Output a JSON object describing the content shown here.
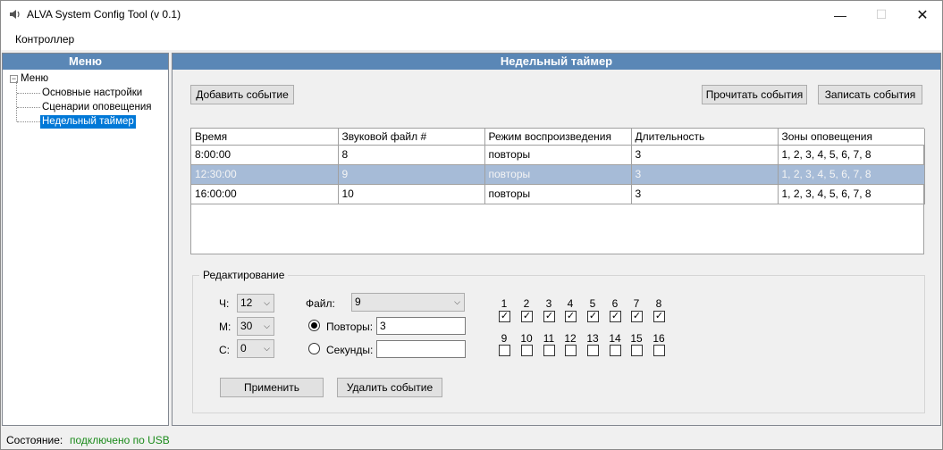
{
  "window": {
    "title": "ALVA System Config Tool (v 0.1)",
    "min_glyph": "—",
    "max_glyph": "☐",
    "close_glyph": "✕"
  },
  "menubar": {
    "controller": "Контроллер"
  },
  "sidebar": {
    "header": "Меню",
    "root": "Меню",
    "items": [
      {
        "label": "Основные настройки"
      },
      {
        "label": "Сценарии оповещения"
      },
      {
        "label": "Недельный таймер"
      }
    ]
  },
  "main": {
    "header": "Недельный таймер",
    "add_event": "Добавить событие",
    "read_events": "Прочитать события",
    "write_events": "Записать события",
    "table": {
      "columns": [
        "Время",
        "Звуковой файл #",
        "Режим воспроизведения",
        "Длительность",
        "Зоны оповещения"
      ],
      "rows": [
        [
          "8:00:00",
          "8",
          "повторы",
          "3",
          "1, 2, 3, 4, 5, 6, 7, 8"
        ],
        [
          "12:30:00",
          "9",
          "повторы",
          "3",
          "1, 2, 3, 4, 5, 6, 7, 8"
        ],
        [
          "16:00:00",
          "10",
          "повторы",
          "3",
          "1, 2, 3, 4, 5, 6, 7, 8"
        ]
      ]
    },
    "edit": {
      "title": "Редактирование",
      "hour_label": "Ч:",
      "hour_value": "12",
      "minute_label": "М:",
      "minute_value": "30",
      "second_label": "С:",
      "second_value": "0",
      "file_label": "Файл:",
      "file_value": "9",
      "repeats_label": "Повторы:",
      "repeats_value": "3",
      "seconds_label": "Секунды:",
      "seconds_value": "",
      "zones": [
        "1",
        "2",
        "3",
        "4",
        "5",
        "6",
        "7",
        "8",
        "9",
        "10",
        "11",
        "12",
        "13",
        "14",
        "15",
        "16"
      ],
      "apply": "Применить",
      "delete_event": "Удалить событие"
    }
  },
  "status": {
    "label": "Состояние:",
    "value": "подключено по USB",
    "value_color": "#1a8a1a"
  },
  "colors": {
    "panel_header": "#5a87b6",
    "selection": "#0078d7",
    "table_selected_row": "#a6bbd7"
  }
}
